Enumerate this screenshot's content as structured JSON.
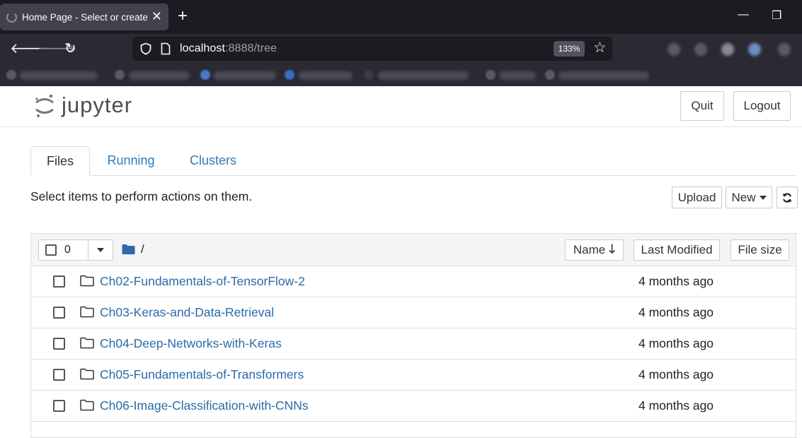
{
  "browser": {
    "tab_title": "Home Page - Select or create a notebook",
    "tab_close": "✕",
    "new_tab": "+",
    "url_host": "localhost",
    "url_rest": ":8888/tree",
    "zoom": "133%"
  },
  "jupyter": {
    "logo_text": "jupyter",
    "quit_label": "Quit",
    "logout_label": "Logout",
    "tabs": [
      {
        "label": "Files"
      },
      {
        "label": "Running"
      },
      {
        "label": "Clusters"
      }
    ],
    "instructions": "Select items to perform actions on them.",
    "upload_label": "Upload",
    "new_label": "New",
    "selected_count": "0",
    "breadcrumb": "/",
    "sort_name_label": "Name",
    "sort_name_arrow": "🡓",
    "last_modified_label": "Last Modified",
    "file_size_label": "File size",
    "files": [
      {
        "name": "Ch02-Fundamentals-of-TensorFlow-2",
        "modified": "4 months ago"
      },
      {
        "name": "Ch03-Keras-and-Data-Retrieval",
        "modified": "4 months ago"
      },
      {
        "name": "Ch04-Deep-Networks-with-Keras",
        "modified": "4 months ago"
      },
      {
        "name": "Ch05-Fundamentals-of-Transformers",
        "modified": "4 months ago"
      },
      {
        "name": "Ch06-Image-Classification-with-CNNs",
        "modified": "4 months ago"
      }
    ]
  },
  "colors": {
    "link": "#337ab7",
    "chrome_dark": "#1c1b22",
    "chrome_bar": "#2b2a33"
  }
}
